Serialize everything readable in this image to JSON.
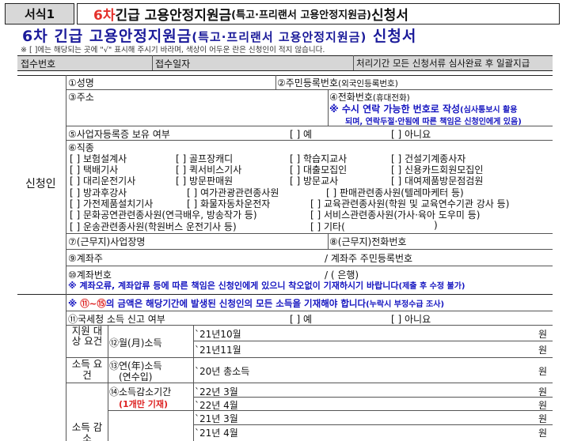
{
  "header": {
    "form_badge": "서식1",
    "title_prefix": "6차",
    "title_main": " 긴급 고용안정지원금",
    "title_paren": "(특고·프리랜서 고용안정지원금)",
    "title_suffix": " 신청서"
  },
  "main_title": {
    "prefix": "6차 긴급 고용안정지원금",
    "paren": "(특고·프리랜서 고용안정지원금)",
    "suffix": " 신청서"
  },
  "note": "※ [ ]에는 해당되는 곳에 \"√\" 표시해 주시기 바라며, 색상이 어두운 란은 신청인이 적지 않습니다.",
  "receipt": {
    "number_label": "접수번호",
    "date_label": "접수일자",
    "processing_label": "처리기간 모든 신청서류 심사완료 후 일괄지급"
  },
  "applicant": {
    "section_label": "신청인",
    "name_label": "①성명",
    "rrn_label": "②주민등록번호",
    "rrn_sub": "(외국인등록번호)",
    "address_label": "③주소",
    "phone_label": "④전화번호",
    "phone_sub": "(휴대전화)",
    "phone_note_main": "※ 수시 연락 가능한 번호로 작성",
    "phone_note_small": "(심사통보시 활용",
    "phone_note_line2": "되며, 연락두절·안됨에 따른 책임은 신청인에게 있음)",
    "biz_label": "⑤사업자등록증 보유 여부",
    "biz_yes": "[ ] 예",
    "biz_no": "[ ] 아니요",
    "job_label": "⑥직종",
    "jobs_row1": [
      "[ ] 보험설계사",
      "[ ] 골프장캐디",
      "[ ] 학습지교사",
      "[ ] 건설기계종사자"
    ],
    "jobs_row2": [
      "[ ] 택배기사",
      "[ ] 퀵서비스기사",
      "[ ] 대출모집인",
      "[ ] 신용카드회원모집인"
    ],
    "jobs_row3": [
      "[ ] 대리운전기사",
      "[ ] 방문판매원",
      "[ ] 방문교사",
      "[ ] 대여제품방문점검원"
    ],
    "jobs_row4": [
      "[ ] 방과후강사",
      "[ ] 여가관광관련종사원",
      "[ ] 판매관련종사원(텔레마케터 등)"
    ],
    "jobs_row5": [
      "[ ] 가전제품설치기사",
      "[ ] 화물자동차운전자",
      "[ ] 교육관련종사원(학원 및 교육연수기관 강사 등)"
    ],
    "jobs_row6": [
      "[ ] 문화공연관련종사원(연극배우, 방송작가 등)",
      "[ ] 서비스관련종사원(가사·육아 도우미 등)"
    ],
    "jobs_row7": [
      "[ ] 운송관련종사원(학원버스 운전기사 등)",
      "[ ] 기타(",
      ")"
    ],
    "workplace_label": "⑦(근무지)사업장명",
    "workplace_phone_label": "⑧(근무지)전화번호",
    "account_owner_label": "⑨계좌주",
    "account_owner_rrn_label": "/ 계좌주 주민등록번호",
    "account_label": "⑩계좌번호",
    "account_bank": "/ (                         은행)",
    "account_note_main": "※ 계좌오류, 계좌압류 등에 따른 책임은 신청인에게 있으니 착오없이 기재하시기 바랍니다",
    "account_note_small": "(제출 후 수정 불가)"
  },
  "income": {
    "notice_prefix": "※ ",
    "notice_range": "⑪~⑮",
    "notice_main": "의 금액은 해당기간에 발생된 신청인의 모든 소득을 기재해야 합니다",
    "notice_small": "(누락시 부정수급 조사)",
    "tax_label": "⑪국세청 소득 신고 여부",
    "tax_yes": "[ ] 예",
    "tax_no": "[ ] 아니요",
    "support_req_label": "지원 대상 요건",
    "monthly_label": "⑫월(月)소득",
    "month1": "`21년10월",
    "month2": "`21년11월",
    "income_req_label": "소득 요건",
    "annual_label": "⑬연(年)소득",
    "annual_sub": "(연수입)",
    "annual_year": "`20년 총소득",
    "decrease_label": "⑭소득감소기간",
    "decrease_note": "(1개만 기재)",
    "dec1": "`22년 3월",
    "dec2": "`22년 4월",
    "dec3": "`21년 3월",
    "dec4": "`21년 4월",
    "decrease_req_label": "소득 감소",
    "won": "원"
  }
}
